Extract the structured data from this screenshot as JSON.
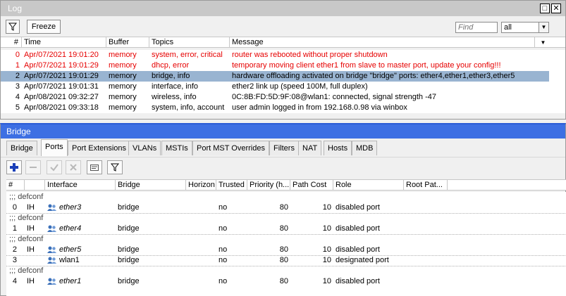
{
  "log": {
    "title": "Log",
    "freeze_label": "Freeze",
    "find_placeholder": "Find",
    "filter_value": "all",
    "columns": [
      "#",
      "Time",
      "Buffer",
      "Topics",
      "Message"
    ],
    "rows": [
      {
        "n": "0",
        "time": "Apr/07/2021 19:01:20",
        "buffer": "memory",
        "topics": "system, error, critical",
        "message": "router was rebooted without proper shutdown"
      },
      {
        "n": "1",
        "time": "Apr/07/2021 19:01:29",
        "buffer": "memory",
        "topics": "dhcp, error",
        "message": "temporary moving client ether1 from slave to master port, update your config!!!"
      },
      {
        "n": "2",
        "time": "Apr/07/2021 19:01:29",
        "buffer": "memory",
        "topics": "bridge, info",
        "message": "hardware offloading activated on bridge \"bridge\" ports: ether4,ether1,ether3,ether5"
      },
      {
        "n": "3",
        "time": "Apr/07/2021 19:01:31",
        "buffer": "memory",
        "topics": "interface, info",
        "message": "ether2 link up (speed 100M, full duplex)"
      },
      {
        "n": "4",
        "time": "Apr/08/2021 09:32:27",
        "buffer": "memory",
        "topics": "wireless, info",
        "message": "0C:8B:FD:5D:9F:08@wlan1: connected, signal strength -47"
      },
      {
        "n": "5",
        "time": "Apr/08/2021 09:33:18",
        "buffer": "memory",
        "topics": "system, info, account",
        "message": "user admin logged in from 192.168.0.98 via winbox"
      }
    ]
  },
  "bridge": {
    "title": "Bridge",
    "tabs": [
      "Bridge",
      "Ports",
      "Port Extensions",
      "VLANs",
      "MSTIs",
      "Port MST Overrides",
      "Filters",
      "NAT",
      "Hosts",
      "MDB"
    ],
    "columns": [
      "#",
      "Interface",
      "Bridge",
      "Horizon",
      "Trusted",
      "Priority (h...",
      "Path Cost",
      "Role",
      "Root Pat..."
    ],
    "comment": ";;; defconf",
    "rows": [
      {
        "n": "0",
        "flags": "IH",
        "iface": "ether3",
        "bridge": "bridge",
        "horizon": "",
        "trusted": "no",
        "priority": "80",
        "cost": "10",
        "role": "disabled port"
      },
      {
        "n": "1",
        "flags": "IH",
        "iface": "ether4",
        "bridge": "bridge",
        "horizon": "",
        "trusted": "no",
        "priority": "80",
        "cost": "10",
        "role": "disabled port"
      },
      {
        "n": "2",
        "flags": "IH",
        "iface": "ether5",
        "bridge": "bridge",
        "horizon": "",
        "trusted": "no",
        "priority": "80",
        "cost": "10",
        "role": "disabled port"
      },
      {
        "n": "3",
        "flags": "",
        "iface": "wlan1",
        "bridge": "bridge",
        "horizon": "",
        "trusted": "no",
        "priority": "80",
        "cost": "10",
        "role": "designated port"
      },
      {
        "n": "4",
        "flags": "IH",
        "iface": "ether1",
        "bridge": "bridge",
        "horizon": "",
        "trusted": "no",
        "priority": "80",
        "cost": "10",
        "role": "disabled port"
      }
    ]
  },
  "colors": {
    "selection": "#99b4d1",
    "error_text": "#e60000",
    "bridge_titlebar": "#3d6fe3",
    "add_icon": "#1a3fb8"
  },
  "icons": [
    "filter-icon",
    "restore-icon",
    "close-icon",
    "dropdown-arrow-icon",
    "add-icon",
    "remove-icon",
    "enable-icon",
    "disable-icon",
    "comment-icon",
    "port-icon"
  ]
}
